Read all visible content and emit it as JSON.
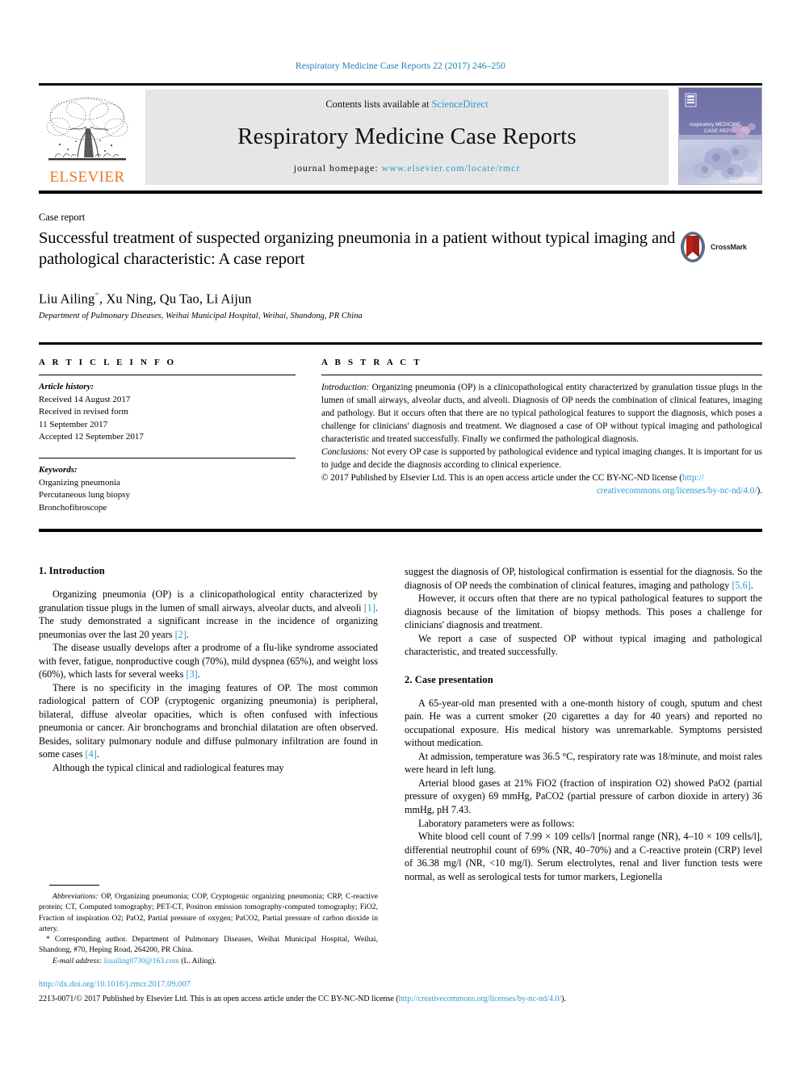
{
  "running_head": "Respiratory Medicine Case Reports 22 (2017) 246–250",
  "masthead": {
    "publisher_name": "ELSEVIER",
    "contents_prefix": "Contents lists available at ",
    "contents_link": "ScienceDirect",
    "journal_name": "Respiratory Medicine Case Reports",
    "homepage_prefix": "journal homepage: ",
    "homepage_url": "www.elsevier.com/locate/rmcr",
    "cover_title_line1": "respiratory MEDICINE",
    "cover_title_line2": "CASE REPORTS"
  },
  "article": {
    "type": "Case report",
    "title": "Successful treatment of suspected organizing pneumonia in a patient without typical imaging and pathological characteristic: A case report",
    "crossmark_label": "CrossMark",
    "authors": "Liu Ailing",
    "authors_rest": ", Xu Ning, Qu Tao, Li Aijun",
    "corresponding_marker": "*",
    "affiliation": "Department of Pulmonary Diseases, Weihai Municipal Hospital, Weihai, Shandong, PR China"
  },
  "info": {
    "heading": "A R T I C L E   I N F O",
    "history_label": "Article history:",
    "history": [
      "Received 14 August 2017",
      "Received in revised form",
      "11 September 2017",
      "Accepted 12 September 2017"
    ],
    "keywords_label": "Keywords:",
    "keywords": [
      "Organizing pneumonia",
      "Percutaneous lung biopsy",
      "Bronchofibroscope"
    ]
  },
  "abstract": {
    "heading": "A B S T R A C T",
    "intro_label": "Introduction:",
    "intro_text": " Organizing pneumonia (OP) is a clinicopathological entity characterized by granulation tissue plugs in the lumen of small airways, alveolar ducts, and alveoli. Diagnosis of OP needs the combination of clinical features, imaging and pathology. But it occurs often that there are no typical pathological features to support the diagnosis, which poses a challenge for clinicians' diagnosis and treatment. We diagnosed a case of OP without typical imaging and pathological characteristic and treated successfully. Finally we confirmed the pathological diagnosis.",
    "conclusions_label": "Conclusions:",
    "conclusions_text": " Not every OP case is supported by pathological evidence and typical imaging changes. It is important for us to judge and decide the diagnosis according to clinical experience.",
    "copyright_text": "© 2017 Published by Elsevier Ltd. This is an open access article under the CC BY-NC-ND license (",
    "copyright_link1": "http://",
    "copyright_link2": "creativecommons.org/licenses/by-nc-nd/4.0/",
    "copyright_tail": ")."
  },
  "body": {
    "sec1_heading": "1. Introduction",
    "sec1_p1_a": "Organizing pneumonia (OP) is a clinicopathological entity characterized by granulation tissue plugs in the lumen of small airways, alveolar ducts, and alveoli ",
    "sec1_p1_ref1": "[1]",
    "sec1_p1_b": ". The study demonstrated a significant increase in the incidence of organizing pneumonias over the last 20 years ",
    "sec1_p1_ref2": "[2]",
    "sec1_p1_c": ".",
    "sec1_p2_a": "The disease usually develops after a prodrome of a flu-like syndrome associated with fever, fatigue, nonproductive cough (70%), mild dyspnea (65%), and weight loss (60%), which lasts for several weeks ",
    "sec1_p2_ref": "[3]",
    "sec1_p2_b": ".",
    "sec1_p3_a": "There is no specificity in the imaging features of OP. The most common radiological pattern of COP (cryptogenic organizing pneumonia) is peripheral, bilateral, diffuse alveolar opacities, which is often confused with infectious pneumonia or cancer. Air bronchograms and bronchial dilatation are often observed. Besides, solitary pulmonary nodule and diffuse pulmonary infiltration are found in some cases ",
    "sec1_p3_ref": "[4]",
    "sec1_p3_b": ".",
    "sec1_p4": "Although the typical clinical and radiological features may",
    "right_p1_a": "suggest the diagnosis of OP, histological confirmation is essential for the diagnosis. So the diagnosis of OP needs the combination of clinical features, imaging and pathology ",
    "right_p1_ref": "[5,6]",
    "right_p1_b": ".",
    "right_p2": "However, it occurs often that there are no typical pathological features to support the diagnosis because of the limitation of biopsy methods. This poses a challenge for clinicians' diagnosis and treatment.",
    "right_p3": "We report a case of suspected OP without typical imaging and pathological characteristic, and treated successfully.",
    "sec2_heading": "2. Case presentation",
    "sec2_p1": "A 65-year-old man presented with a one-month history of cough, sputum and chest pain. He was a current smoker (20 cigarettes a day for 40 years) and reported no occupational exposure. His medical history was unremarkable. Symptoms persisted without medication.",
    "sec2_p2": "At admission, temperature was 36.5 °C, respiratory rate was 18/minute, and moist rales were heard in left lung.",
    "sec2_p3": "Arterial blood gases at 21% FiO2 (fraction of inspiration O2) showed PaO2 (partial pressure of oxygen) 69 mmHg, PaCO2 (partial pressure of carbon dioxide in artery) 36 mmHg, pH 7.43.",
    "sec2_p4": "Laboratory parameters were as follows:",
    "sec2_p5": "White blood cell count of 7.99 × 109 cells/l [normal range (NR), 4–10 × 109 cells/l], differential neutrophil count of 69% (NR, 40–70%) and a C-reactive protein (CRP) level of 36.38 mg/l (NR, <10 mg/l). Serum electrolytes, renal and liver function tests were normal, as well as serological tests for tumor markers, Legionella"
  },
  "footnotes": {
    "abbrev_label": "Abbreviations:",
    "abbrev_text": " OP, Organizing pneumonia; COP, Cryptogenic organizing pneumonia; CRP, C-reactive protein; CT, Computed tomography; PET-CT, Positron emission tomography-computed tomography; FiO2, Fraction of inspiration O2; PaO2, Partial pressure of oxygen; PaCO2, Partial pressure of carbon dioxide in artery.",
    "corresponding_marker": "*",
    "corresponding_text": " Corresponding author. Department of Pulmonary Diseases, Weihai Municipal Hospital, Weihai, Shandong, #70, Heping Road, 264200, PR China.",
    "email_label": "E-mail address:",
    "email": "liuailing0730@163.com",
    "email_suffix": " (L. Ailing)."
  },
  "footer": {
    "doi": "http://dx.doi.org/10.1016/j.rmcr.2017.09.007",
    "issn_copyright": "2213-0071/© 2017 Published by Elsevier Ltd. This is an open access article under the CC BY-NC-ND license (",
    "license_url": "http://creativecommons.org/licenses/by-nc-nd/4.0/",
    "license_tail": ")."
  },
  "colors": {
    "link_blue": "#2e9ad0",
    "running_head_blue": "#1a7fb5",
    "elsevier_orange": "#E87722",
    "band_gray": "#e6e6e6",
    "crossmark_red": "#b5241a",
    "cover_purple": "#6e6fa8"
  }
}
